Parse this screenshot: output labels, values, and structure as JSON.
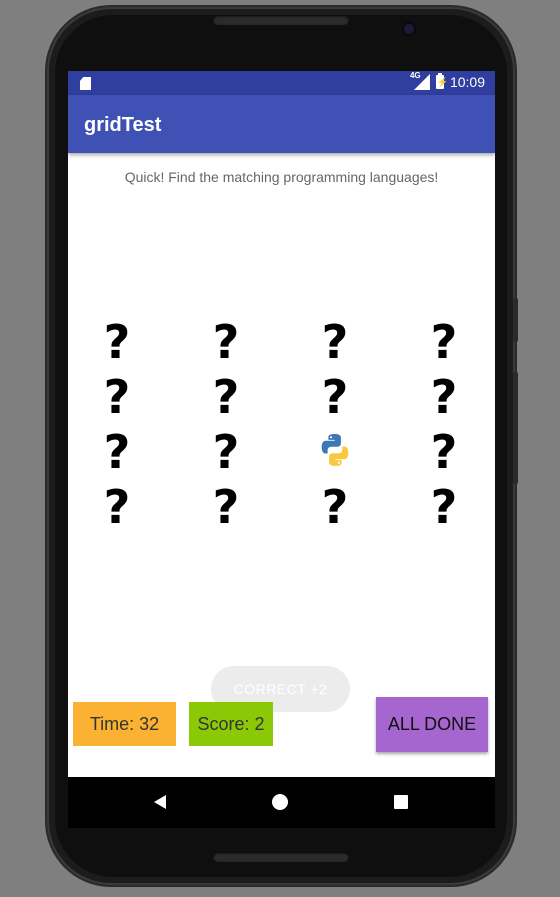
{
  "statusbar": {
    "network_label": "4G",
    "battery_label": "⚡",
    "time": "10:09"
  },
  "appbar": {
    "title": "gridTest"
  },
  "game": {
    "instruction": "Quick! Find the matching programming languages!",
    "rows": 4,
    "cols": 4,
    "cells": [
      {
        "state": "hidden",
        "symbol": "?"
      },
      {
        "state": "hidden",
        "symbol": "?"
      },
      {
        "state": "hidden",
        "symbol": "?"
      },
      {
        "state": "hidden",
        "symbol": "?"
      },
      {
        "state": "hidden",
        "symbol": "?"
      },
      {
        "state": "hidden",
        "symbol": "?"
      },
      {
        "state": "hidden",
        "symbol": "?"
      },
      {
        "state": "hidden",
        "symbol": "?"
      },
      {
        "state": "hidden",
        "symbol": "?"
      },
      {
        "state": "hidden",
        "symbol": "?"
      },
      {
        "state": "revealed",
        "icon": "python-icon"
      },
      {
        "state": "hidden",
        "symbol": "?"
      },
      {
        "state": "hidden",
        "symbol": "?"
      },
      {
        "state": "hidden",
        "symbol": "?"
      },
      {
        "state": "hidden",
        "symbol": "?"
      },
      {
        "state": "hidden",
        "symbol": "?"
      }
    ],
    "toast": "CORRECT  +2",
    "time_label": "Time: 32",
    "score_label": "Score: 2",
    "done_label": "ALL DONE"
  },
  "colors": {
    "statusbar": "#303f9f",
    "appbar": "#3f51b5",
    "time_box": "#fbb233",
    "score_box": "#8bc906",
    "done_button": "#a566cf",
    "python_blue": "#3c78b4",
    "python_yellow": "#f7c93f"
  },
  "navbar": {
    "icons": [
      "back-icon",
      "home-icon",
      "recents-icon"
    ]
  }
}
